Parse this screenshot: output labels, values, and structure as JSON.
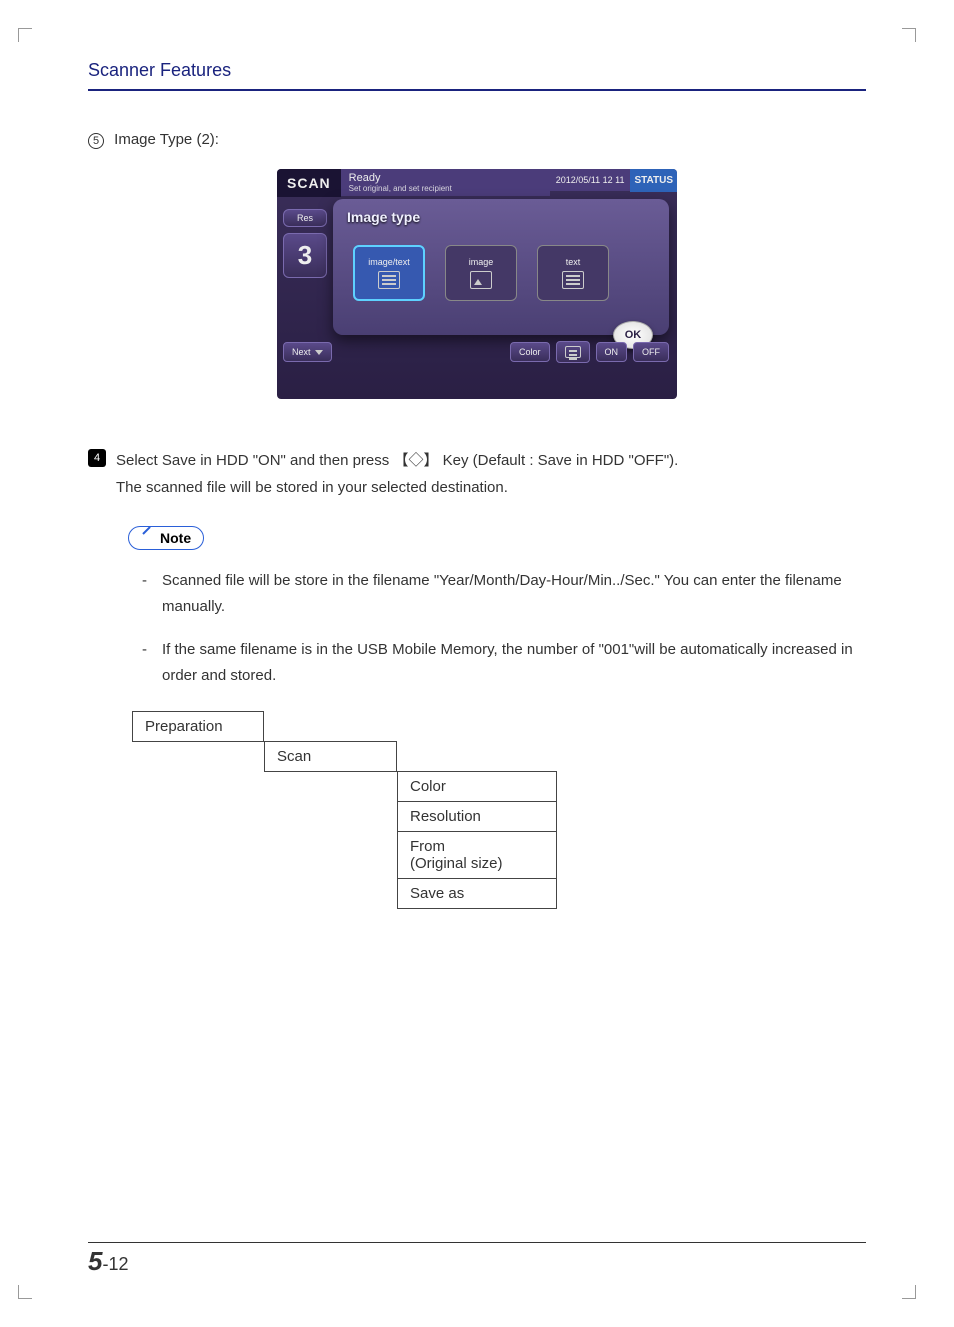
{
  "header": {
    "title": "Scanner Features"
  },
  "step5": {
    "circle": "5",
    "label": "Image Type (2):"
  },
  "screenshot": {
    "scan_label": "SCAN",
    "ready": "Ready",
    "ready_sub": "Set original, and set recipient",
    "datetime": "2012/05/11 12 11",
    "status": "STATUS",
    "left_btn": "Res",
    "left_num": "3",
    "popup_title": "Image type",
    "opt1": "image/text",
    "opt2": "image",
    "opt3": "text",
    "ok": "OK",
    "next": "Next",
    "color": "Color",
    "on": "ON",
    "off": "OFF"
  },
  "step4": {
    "badge": "4",
    "line1": "Select Save in HDD \"ON\" and then press 【◇】 Key (Default : Save in HDD \"OFF\").",
    "line2": "The scanned file will be stored in your selected destination."
  },
  "note": {
    "label": "Note",
    "item1_pre": "Scanned file will be store in the filename ",
    "item1_bold": "\"Year/Month/Day-Hour/Min../Sec.\"",
    "item1_post": " You can enter the filename manually.",
    "item2_pre": "If the same filename is in the USB Mobile Memory, the number of  ",
    "item2_bold": "\"001\"",
    "item2_post": "will be automatically increased in order and stored."
  },
  "menu": {
    "l1": "Preparation",
    "l2": "Scan",
    "l3a": "Color",
    "l3b": "Resolution",
    "l3c1": "From",
    "l3c2": "(Original size)",
    "l3d": "Save as"
  },
  "footer": {
    "chapter": "5",
    "sep": "-",
    "page": "12"
  }
}
